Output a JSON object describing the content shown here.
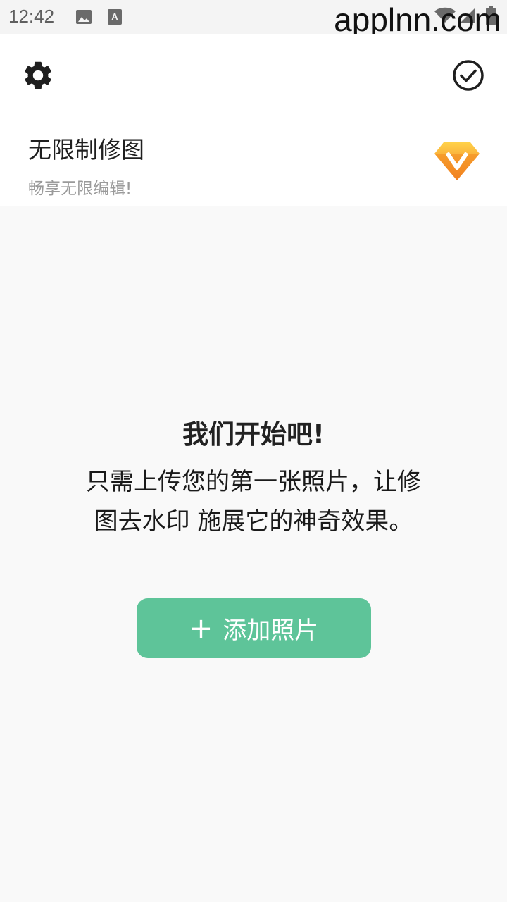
{
  "status_bar": {
    "time": "12:42",
    "icons": [
      "image-icon",
      "keyboard-a-icon",
      "wifi-icon",
      "signal-icon",
      "battery-icon"
    ]
  },
  "watermark": "applnn.com",
  "toolbar": {
    "settings_icon": "gear-icon",
    "confirm_icon": "check-circle-icon"
  },
  "promo": {
    "title": "无限制修图",
    "subtitle": "畅享无限编辑!",
    "icon": "vip-diamond-icon"
  },
  "empty_state": {
    "title": "我们开始吧!",
    "message": "只需上传您的第一张照片，让修图去水印 施展它的神奇效果。",
    "button_plus": "+",
    "button_label": "添加照片"
  },
  "colors": {
    "accent": "#5ec499",
    "background": "#f9f9f9",
    "surface": "#ffffff",
    "gem_orange": "#f6a623"
  }
}
